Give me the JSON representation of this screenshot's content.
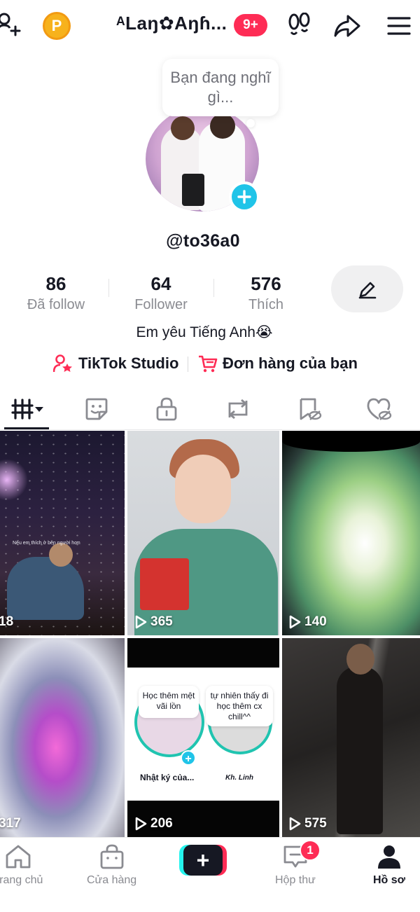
{
  "header": {
    "title": "ᴬLaŋ✿Aŋɦ...",
    "notification_badge": "9+"
  },
  "profile": {
    "status_bubble": "Bạn đang nghĩ gì...",
    "username": "@to36a0",
    "bio": "Em yêu Tiếng Anh😭"
  },
  "stats": [
    {
      "value": "86",
      "label": "Đã follow"
    },
    {
      "value": "64",
      "label": "Follower"
    },
    {
      "value": "576",
      "label": "Thích"
    }
  ],
  "links": {
    "studio": "TikTok Studio",
    "orders": "Đơn hàng của bạn"
  },
  "tabs": [
    {
      "icon": "videos-grid-icon",
      "active": true
    },
    {
      "icon": "sticker-icon"
    },
    {
      "icon": "lock-icon"
    },
    {
      "icon": "repost-icon"
    },
    {
      "icon": "favorites-hidden-icon"
    },
    {
      "icon": "liked-hidden-icon"
    }
  ],
  "videos": [
    {
      "views": "18",
      "caption": "Nếu em thích ở bên người hơn"
    },
    {
      "views": "365"
    },
    {
      "views": "140"
    },
    {
      "views": "317"
    },
    {
      "views": "206",
      "bubble_left": "Học thêm mệt vãi lồn",
      "bubble_right": "tự nhiên thấy đi học thêm cx chill^^",
      "caption_left": "Nhật ký của...",
      "caption_right": "Kh. Linh"
    },
    {
      "views": "575"
    }
  ],
  "bottom_nav": {
    "home": "Trang chủ",
    "shop": "Cửa hàng",
    "create": "+",
    "inbox": "Hộp thư",
    "inbox_badge": "1",
    "profile": "Hồ sơ"
  },
  "colors": {
    "brand_red": "#fe2c55",
    "brand_cyan": "#25f4ee",
    "coin": "#f7b21c",
    "text_primary": "#161823",
    "text_secondary": "#8a8b91"
  }
}
